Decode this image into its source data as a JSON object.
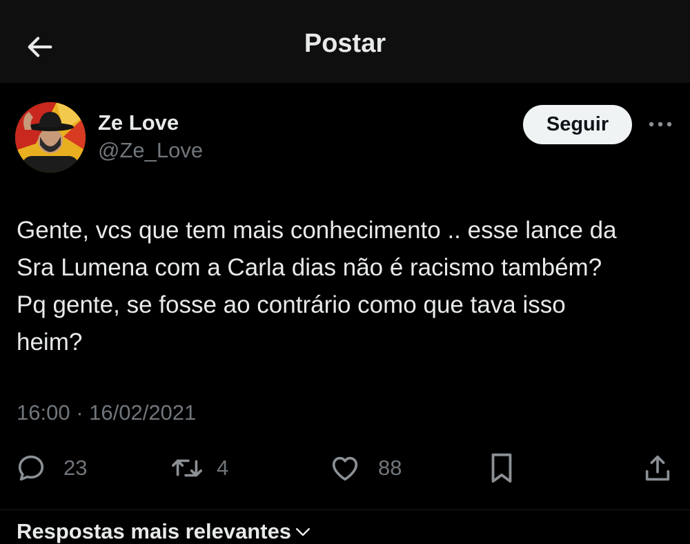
{
  "header": {
    "title": "Postar",
    "back_icon": "arrow-left-icon"
  },
  "author": {
    "display_name": "Ze Love",
    "handle": "@Ze_Love",
    "follow_label": "Seguir",
    "more_icon": "more-horizontal-icon"
  },
  "tweet": {
    "lines": [
      "Gente, vcs que tem mais conhecimento .. esse lance da",
      "Sra Lumena com a Carla dias não é racismo também?",
      "Pq gente, se fosse ao contrário como que tava isso",
      "heim?"
    ],
    "timestamp": "16:00 · 16/02/2021"
  },
  "actions": {
    "reply": {
      "icon": "reply-icon",
      "count": "23"
    },
    "retweet": {
      "icon": "retweet-icon",
      "count": "4"
    },
    "like": {
      "icon": "heart-icon",
      "count": "88"
    },
    "bookmark": {
      "icon": "bookmark-icon"
    },
    "share": {
      "icon": "share-icon"
    }
  },
  "replies": {
    "sort_label": "Respostas mais relevantes",
    "sort_icon": "chevron-down-icon"
  },
  "colors": {
    "background": "#000000",
    "header_background": "#0f0f0f",
    "text_primary": "#e7e9ea",
    "text_secondary": "#71767b",
    "follow_button_bg": "#eff3f4",
    "follow_button_text": "#0f1419"
  }
}
